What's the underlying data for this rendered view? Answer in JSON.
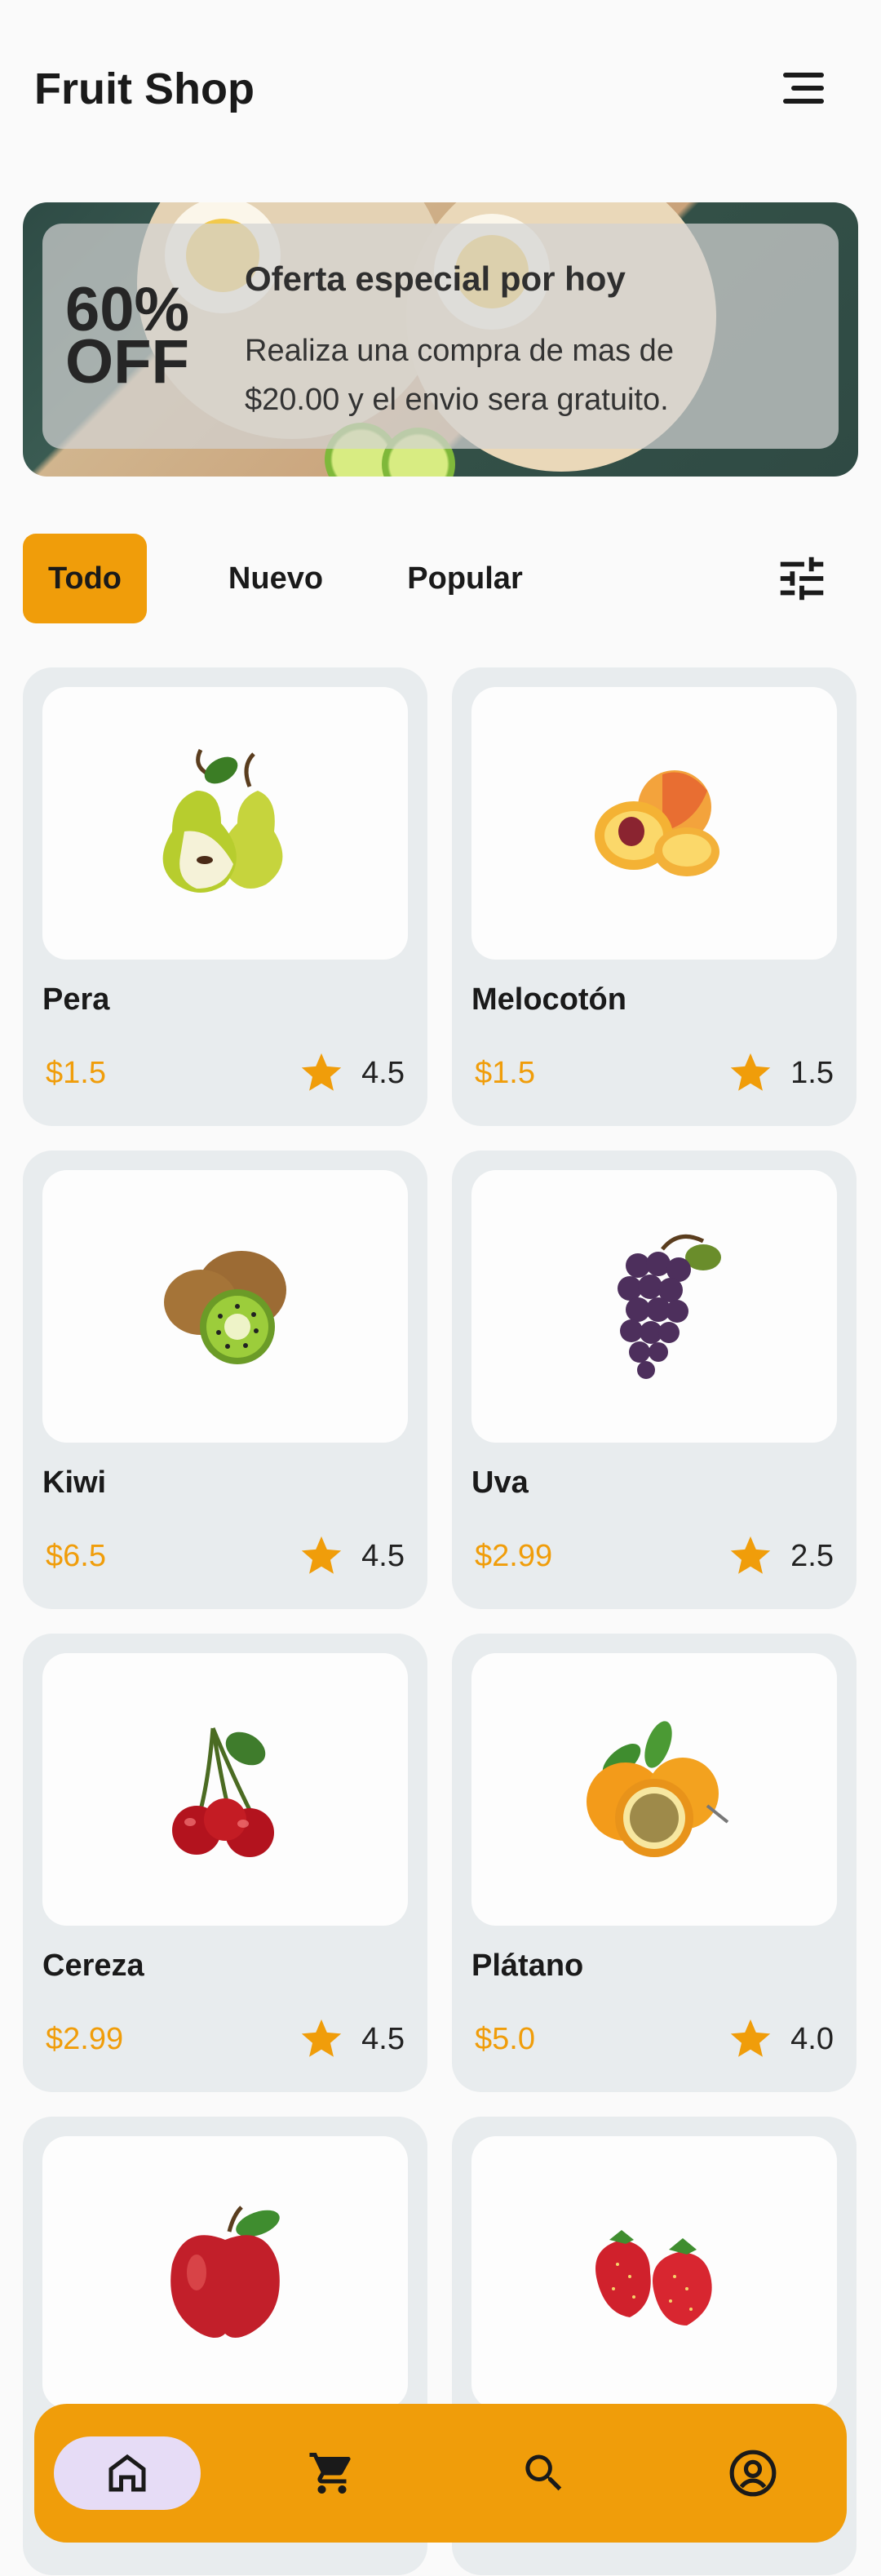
{
  "header": {
    "title": "Fruit Shop",
    "menu_icon": "menu-icon"
  },
  "banner": {
    "discount": "60% OFF",
    "title": "Oferta especial por hoy",
    "text": "Realiza una compra de mas de $20.00 y el envio sera gratuito."
  },
  "tabs": [
    {
      "label": "Todo",
      "active": true
    },
    {
      "label": "Nuevo",
      "active": false
    },
    {
      "label": "Popular",
      "active": false
    }
  ],
  "filter_icon": "tune-icon",
  "products": [
    {
      "name": "Pera",
      "price": "$1.5",
      "rating": "4.5",
      "image": "pear"
    },
    {
      "name": "Melocotón",
      "price": "$1.5",
      "rating": "1.5",
      "image": "peach"
    },
    {
      "name": "Kiwi",
      "price": "$6.5",
      "rating": "4.5",
      "image": "kiwi"
    },
    {
      "name": "Uva",
      "price": "$2.99",
      "rating": "2.5",
      "image": "grapes"
    },
    {
      "name": "Cereza",
      "price": "$2.99",
      "rating": "4.5",
      "image": "cherry"
    },
    {
      "name": "Plátano",
      "price": "$5.0",
      "rating": "4.0",
      "image": "passion-fruit"
    },
    {
      "name": "",
      "price": "",
      "rating": "",
      "image": "apple"
    },
    {
      "name": "",
      "price": "",
      "rating": "",
      "image": "strawberry"
    }
  ],
  "bottom_nav": [
    {
      "icon": "home-icon",
      "active": true
    },
    {
      "icon": "cart-icon",
      "active": false
    },
    {
      "icon": "search-icon",
      "active": false
    },
    {
      "icon": "account-icon",
      "active": false
    }
  ],
  "colors": {
    "accent": "#f09d0a",
    "card_bg": "#e8ecee",
    "nav_active": "#e6dcf6"
  }
}
